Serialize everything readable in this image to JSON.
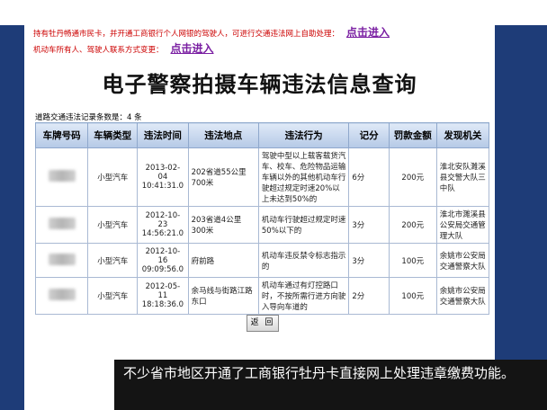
{
  "colors": {
    "side_band": "#1e3c78",
    "notice_text": "#cc0000",
    "link": "#7a1fa2",
    "caption_bg": "#141414"
  },
  "notices": [
    {
      "text": "持有牡丹畅通市民卡，并开通工商银行个人网银的驾驶人，可进行交通违法网上自助处理：",
      "link": "点击进入"
    },
    {
      "text": "机动车所有人、驾驶人联系方式变更：",
      "link": "点击进入"
    }
  ],
  "title": "电子警察拍摄车辆违法信息查询",
  "record_count": "道路交通违法记录条数是：4 条",
  "table": {
    "headers": [
      "车牌号码",
      "车辆类型",
      "违法时间",
      "违法地点",
      "违法行为",
      "记分",
      "罚款金额",
      "发现机关"
    ],
    "rows": [
      {
        "vehicle_type": "小型汽车",
        "time": "2013-02-04 10:41:31.0",
        "location": "202省道55公里700米",
        "violation": "驾驶中型以上载客载货汽车、校车、危险物品运输车辆以外的其他机动车行驶超过规定时速20%以上未达到50%的",
        "points": "6分",
        "fine": "200元",
        "office": "淮北安队濉溪县交警大队三中队"
      },
      {
        "vehicle_type": "小型汽车",
        "time": "2012-10-23 14:56:21.0",
        "location": "203省道4公里300米",
        "violation": "机动车行驶超过规定时速50%以下的",
        "points": "3分",
        "fine": "200元",
        "office": "淮北市濉溪县公安局交通管理大队"
      },
      {
        "vehicle_type": "小型汽车",
        "time": "2012-10-16 09:09:56.0",
        "location": "府前路",
        "violation": "机动车违反禁令标志指示的",
        "points": "3分",
        "fine": "100元",
        "office": "余姚市公安局交通警察大队"
      },
      {
        "vehicle_type": "小型汽车",
        "time": "2012-05-11 18:18:36.0",
        "location": "余马线与街路江路东口",
        "violation": "机动车通过有灯控路口时，不按所需行进方向驶入导向车道的",
        "points": "2分",
        "fine": "100元",
        "office": "余姚市公安局交通警察大队"
      }
    ]
  },
  "back_button": "返 回",
  "caption": "不少省市地区开通了工商银行牡丹卡直接网上处理违章缴费功能。"
}
